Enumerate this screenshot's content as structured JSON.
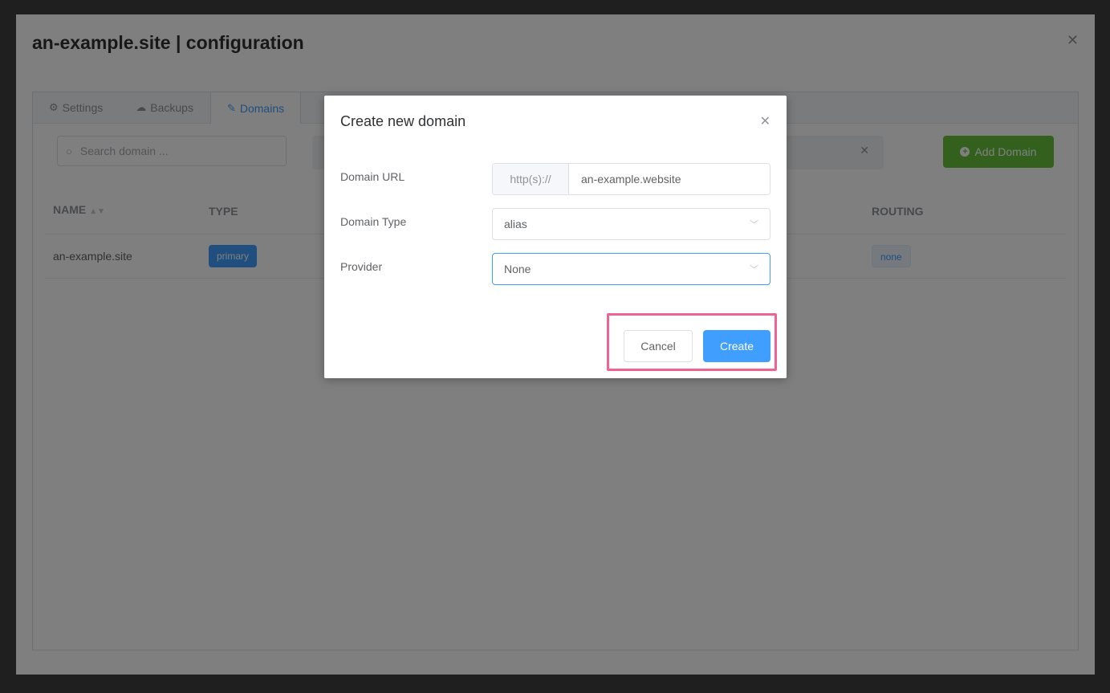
{
  "panel": {
    "title": "an-example.site | configuration",
    "close_icon": "close-icon"
  },
  "tabs": [
    {
      "label": "Settings",
      "icon": "gear-icon",
      "active": false
    },
    {
      "label": "Backups",
      "icon": "cloud-icon",
      "active": false
    },
    {
      "label": "Domains",
      "icon": "edit-icon",
      "active": true
    }
  ],
  "toolbar": {
    "search_placeholder": "Search domain ...",
    "add_label": "Add Domain"
  },
  "table": {
    "columns": [
      "NAME",
      "TYPE",
      "ROUTING"
    ],
    "rows": [
      {
        "name": "an-example.site",
        "type": "primary",
        "routing": "none"
      }
    ]
  },
  "dialog": {
    "title": "Create new domain",
    "fields": {
      "url_label": "Domain URL",
      "url_prefix": "http(s)://",
      "url_value": "an-example.website",
      "type_label": "Domain Type",
      "type_value": "alias",
      "provider_label": "Provider",
      "provider_value": "None"
    },
    "cancel_label": "Cancel",
    "create_label": "Create"
  },
  "colors": {
    "accent": "#409eff",
    "success": "#67c23a",
    "highlight": "#f06292"
  }
}
